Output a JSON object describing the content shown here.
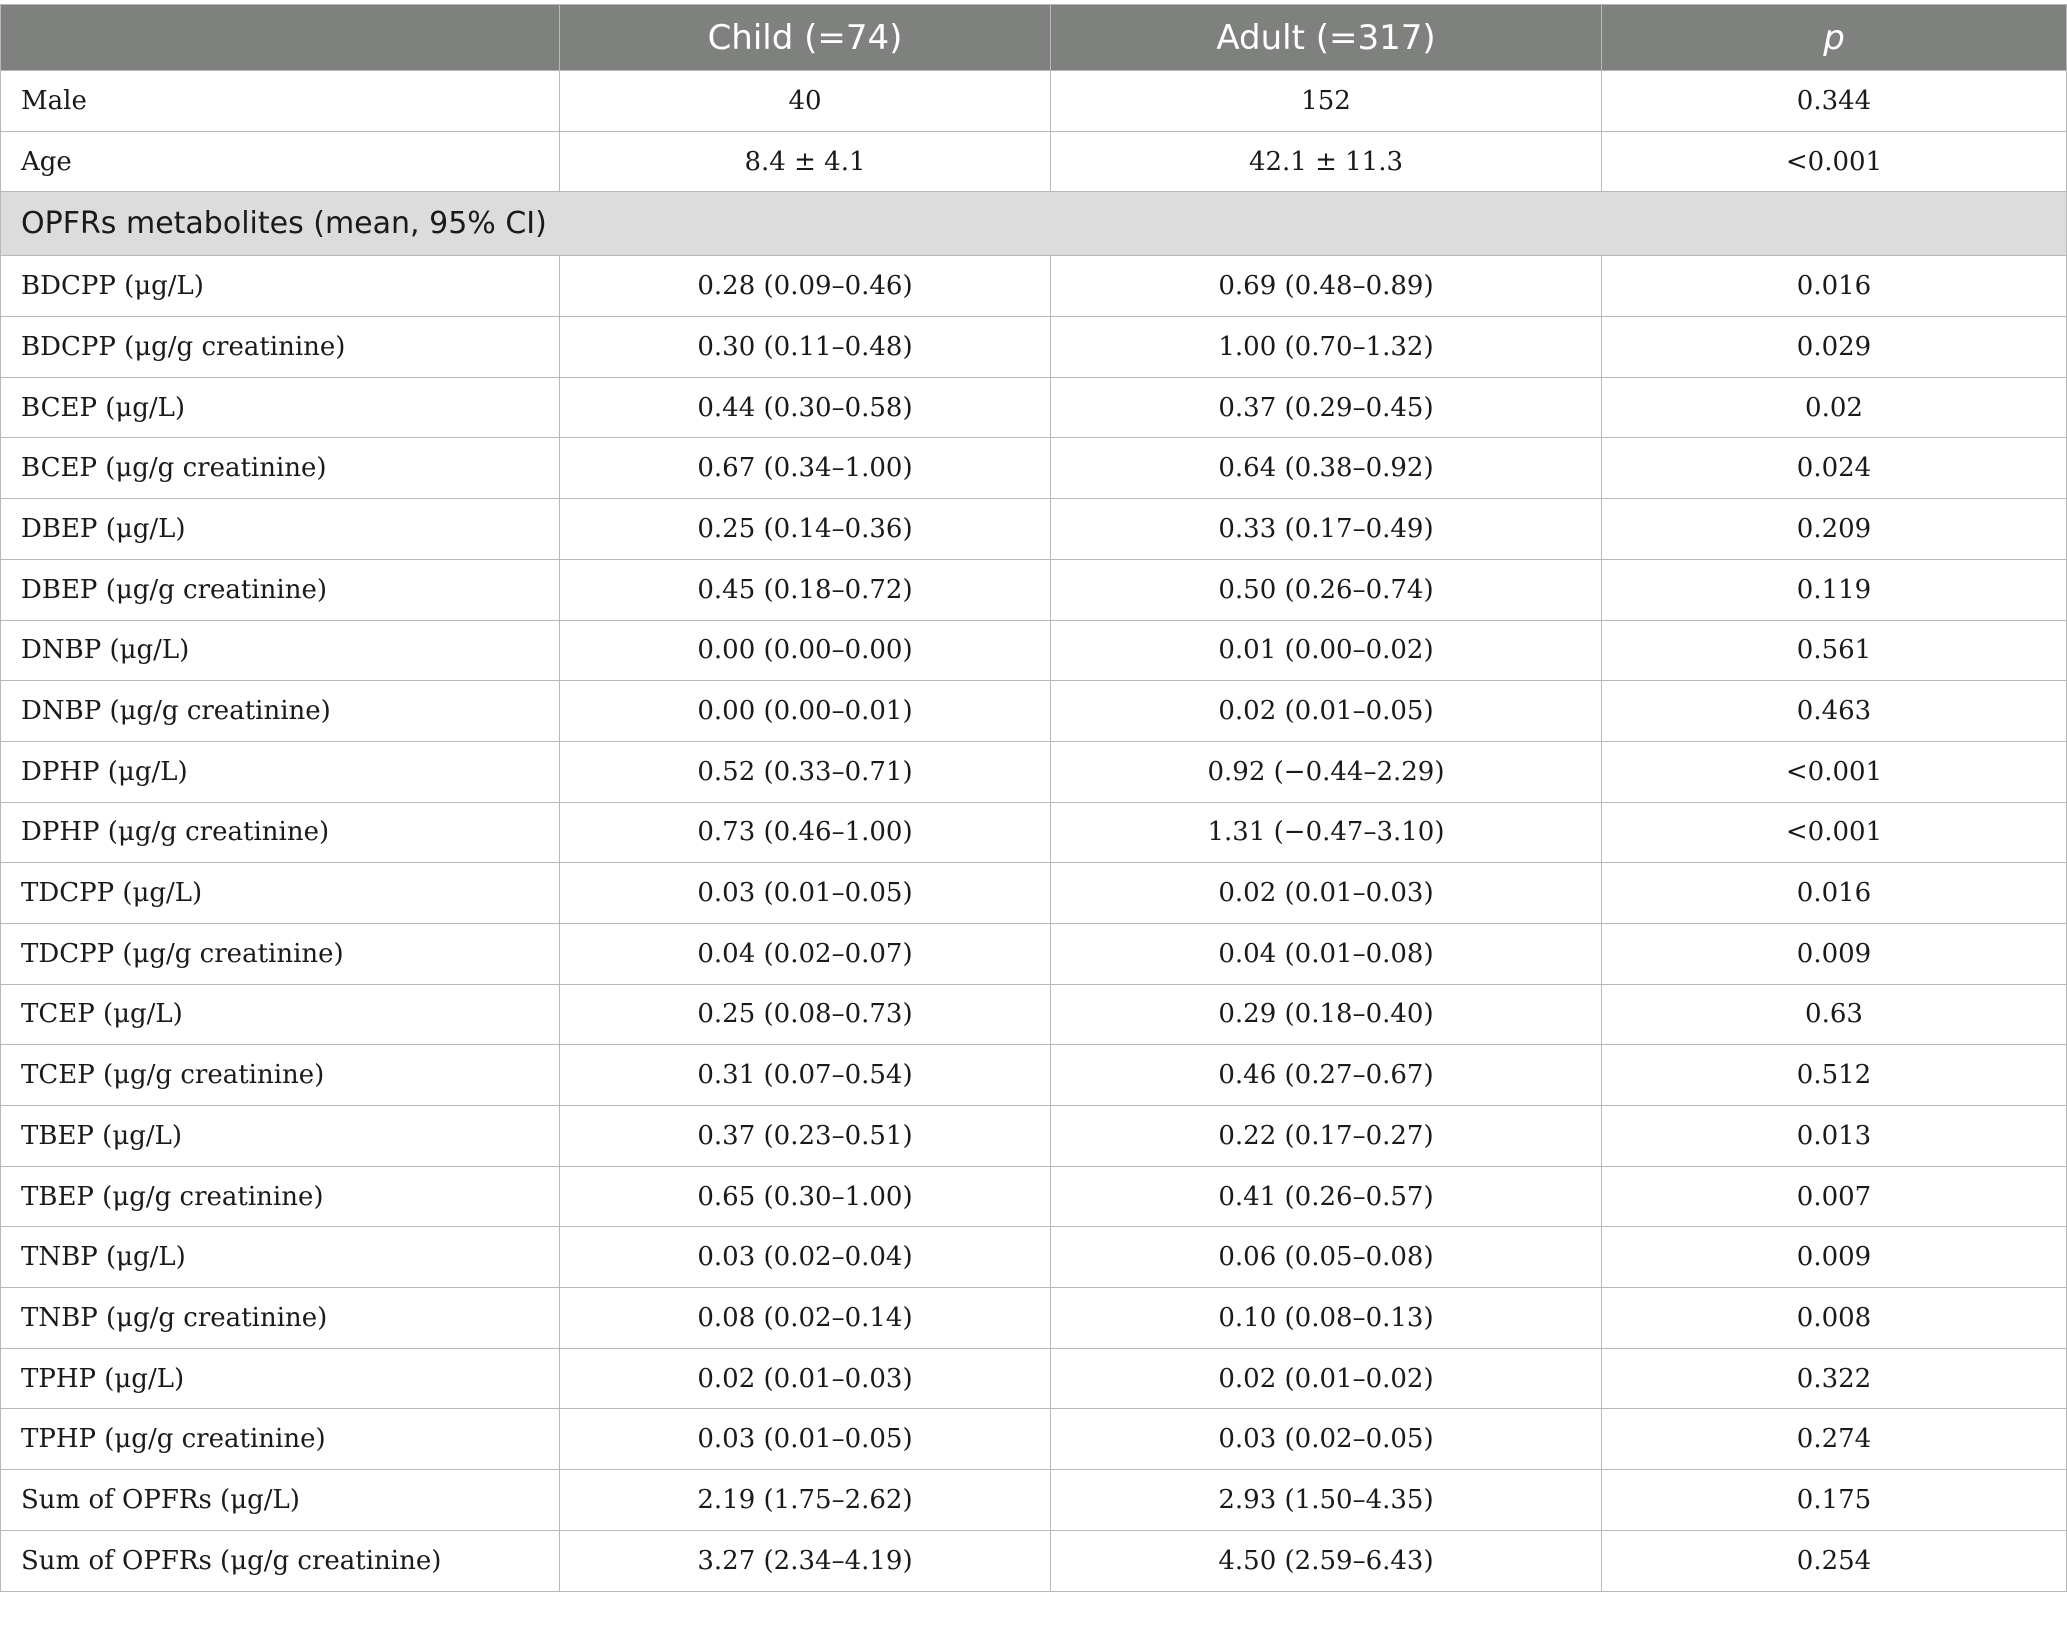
{
  "table": {
    "headers": [
      "",
      "Child (=74)",
      "Adult (=317)",
      "p"
    ],
    "top_rows": [
      [
        "Male",
        "40",
        "152",
        "0.344"
      ],
      [
        "Age",
        "8.4 ± 4.1",
        "42.1 ± 11.3",
        "<0.001"
      ]
    ],
    "section_label": "OPFRs metabolites (mean, 95% CI)",
    "rows": [
      [
        "BDCPP (μg/L)",
        "0.28 (0.09–0.46)",
        "0.69 (0.48–0.89)",
        "0.016"
      ],
      [
        "BDCPP (μg/g creatinine)",
        "0.30 (0.11–0.48)",
        "1.00 (0.70–1.32)",
        "0.029"
      ],
      [
        "BCEP (μg/L)",
        "0.44 (0.30–0.58)",
        "0.37 (0.29–0.45)",
        "0.02"
      ],
      [
        "BCEP (μg/g creatinine)",
        "0.67 (0.34–1.00)",
        "0.64 (0.38–0.92)",
        "0.024"
      ],
      [
        "DBEP (μg/L)",
        "0.25 (0.14–0.36)",
        "0.33 (0.17–0.49)",
        "0.209"
      ],
      [
        "DBEP (μg/g creatinine)",
        "0.45 (0.18–0.72)",
        "0.50 (0.26–0.74)",
        "0.119"
      ],
      [
        "DNBP (μg/L)",
        "0.00 (0.00–0.00)",
        "0.01 (0.00–0.02)",
        "0.561"
      ],
      [
        "DNBP (μg/g creatinine)",
        "0.00 (0.00–0.01)",
        "0.02 (0.01–0.05)",
        "0.463"
      ],
      [
        "DPHP (μg/L)",
        "0.52 (0.33–0.71)",
        "0.92 (−0.44–2.29)",
        "<0.001"
      ],
      [
        "DPHP (μg/g creatinine)",
        "0.73 (0.46–1.00)",
        "1.31 (−0.47–3.10)",
        "<0.001"
      ],
      [
        "TDCPP (μg/L)",
        "0.03 (0.01–0.05)",
        "0.02 (0.01–0.03)",
        "0.016"
      ],
      [
        "TDCPP (μg/g creatinine)",
        "0.04 (0.02–0.07)",
        "0.04 (0.01–0.08)",
        "0.009"
      ],
      [
        "TCEP (μg/L)",
        "0.25 (0.08–0.73)",
        "0.29 (0.18–0.40)",
        "0.63"
      ],
      [
        "TCEP (μg/g creatinine)",
        "0.31 (0.07–0.54)",
        "0.46 (0.27–0.67)",
        "0.512"
      ],
      [
        "TBEP (μg/L)",
        "0.37 (0.23–0.51)",
        "0.22 (0.17–0.27)",
        "0.013"
      ],
      [
        "TBEP (μg/g creatinine)",
        "0.65 (0.30–1.00)",
        "0.41 (0.26–0.57)",
        "0.007"
      ],
      [
        "TNBP (μg/L)",
        "0.03 (0.02–0.04)",
        "0.06 (0.05–0.08)",
        "0.009"
      ],
      [
        "TNBP (μg/g creatinine)",
        "0.08 (0.02–0.14)",
        "0.10 (0.08–0.13)",
        "0.008"
      ],
      [
        "TPHP (μg/L)",
        "0.02 (0.01–0.03)",
        "0.02 (0.01–0.02)",
        "0.322"
      ],
      [
        "TPHP (μg/g creatinine)",
        "0.03 (0.01–0.05)",
        "0.03 (0.02–0.05)",
        "0.274"
      ],
      [
        "Sum of OPFRs (μg/L)",
        "2.19 (1.75–2.62)",
        "2.93 (1.50–4.35)",
        "0.175"
      ],
      [
        "Sum of OPFRs (μg/g creatinine)",
        "3.27 (2.34–4.19)",
        "4.50 (2.59–6.43)",
        "0.254"
      ]
    ]
  },
  "colors": {
    "header_bg": "#7f817e",
    "section_bg": "#dcdcdc",
    "border": "#b8b8b8"
  }
}
